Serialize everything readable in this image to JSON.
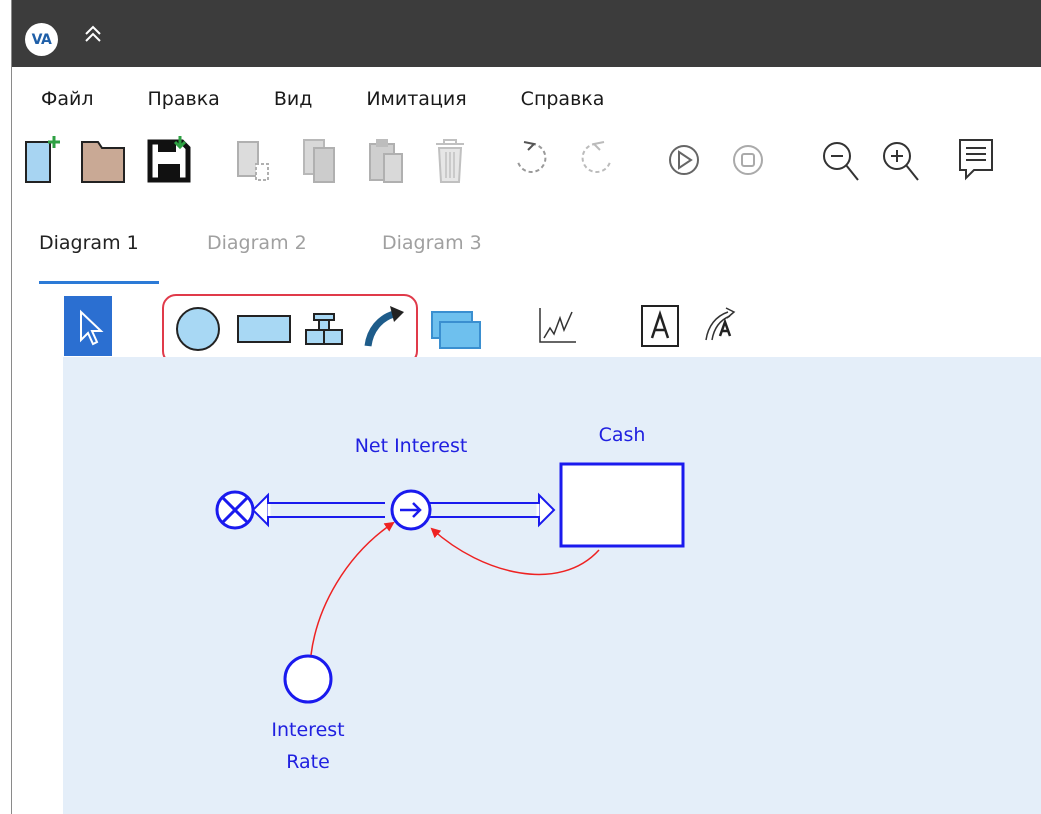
{
  "app": {
    "logo_text": "VA",
    "colors": {
      "titlebar": "#3c3c3c",
      "accent": "#2b6fd1",
      "canvas": "#e4eef9",
      "model_blue": "#1a1aee",
      "link_red": "#ee2222"
    }
  },
  "menu": {
    "items": [
      {
        "label": "Файл"
      },
      {
        "label": "Правка"
      },
      {
        "label": "Вид"
      },
      {
        "label": "Имитация"
      },
      {
        "label": "Справка"
      }
    ]
  },
  "toolbar": {
    "buttons": [
      {
        "icon": "new-file-icon",
        "enabled": true
      },
      {
        "icon": "open-folder-icon",
        "enabled": true
      },
      {
        "icon": "save-icon",
        "enabled": true
      },
      {
        "icon": "cut-icon",
        "enabled": false
      },
      {
        "icon": "copy-icon",
        "enabled": false
      },
      {
        "icon": "paste-icon",
        "enabled": false
      },
      {
        "icon": "delete-icon",
        "enabled": false
      },
      {
        "icon": "undo-icon",
        "enabled": false
      },
      {
        "icon": "redo-icon",
        "enabled": false
      },
      {
        "icon": "run-icon",
        "enabled": false
      },
      {
        "icon": "stop-icon",
        "enabled": false
      },
      {
        "icon": "zoom-out-icon",
        "enabled": true
      },
      {
        "icon": "zoom-in-icon",
        "enabled": true
      },
      {
        "icon": "comments-icon",
        "enabled": true
      }
    ]
  },
  "tabs": [
    {
      "label": "Diagram 1",
      "active": true
    },
    {
      "label": "Diagram 2",
      "active": false
    },
    {
      "label": "Diagram 3",
      "active": false
    }
  ],
  "palette": {
    "tools": [
      "select-tool-icon",
      "auxiliary-tool-icon",
      "stock-tool-icon",
      "flow-tool-icon",
      "link-tool-icon",
      "module-tool-icon",
      "graph-tool-icon",
      "text-tool-icon",
      "curved-text-tool-icon"
    ],
    "selected": "select-tool-icon"
  },
  "diagram": {
    "flow_label": "Net Interest",
    "stock_label": "Cash",
    "aux_label_line1": "Interest",
    "aux_label_line2": "Rate"
  }
}
